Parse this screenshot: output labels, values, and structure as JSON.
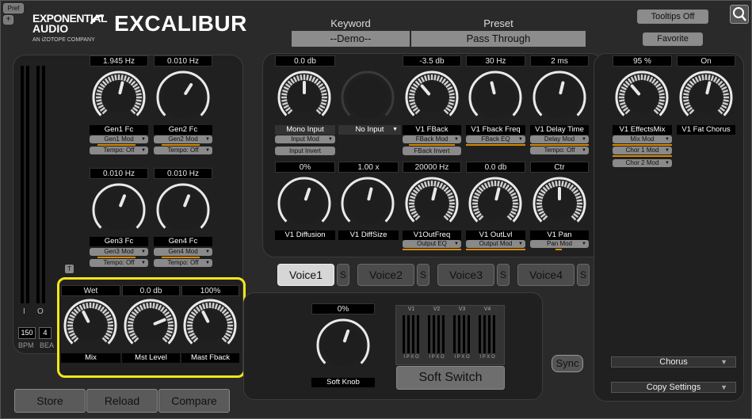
{
  "header": {
    "pref_label": "Pref",
    "plus_label": "+",
    "brand_line1": "EXPONENTIAL",
    "brand_line2": "AUDIO",
    "brand_sub": "AN iZOTOPE COMPANY",
    "product": "EXCALIBUR",
    "keyword_label": "Keyword",
    "keyword_value": "--Demo--",
    "preset_label": "Preset",
    "preset_value": "Pass Through",
    "tooltips_label": "Tooltips Off",
    "favorite_label": "Favorite"
  },
  "left": {
    "meter_i": "I",
    "meter_o": "O",
    "bpm_value": "150",
    "beat_value": "4",
    "bpm_label": "BPM",
    "beat_label": "BEA",
    "t_label": "T"
  },
  "gens": [
    {
      "value": "1.945 Hz",
      "label": "Gen1 Fc",
      "mod": "Gen1 Mod",
      "tempo": "Tempo: Off"
    },
    {
      "value": "0.010 Hz",
      "label": "Gen2 Fc",
      "mod": "Gen2 Mod",
      "tempo": "Tempo: Off"
    },
    {
      "value": "0.010 Hz",
      "label": "Gen3 Fc",
      "mod": "Gen3 Mod",
      "tempo": "Tempo: Off"
    },
    {
      "value": "0.010 Hz",
      "label": "Gen4 Fc",
      "mod": "Gen4 Mod",
      "tempo": "Tempo: Off"
    }
  ],
  "master": {
    "mix_value": "Wet",
    "mix_label": "Mix",
    "level_value": "0.0 db",
    "level_label": "Mst Level",
    "fback_value": "100%",
    "fback_label": "Mast Fback"
  },
  "voice_row1": {
    "input_value": "0.0 db",
    "input_label": "Mono Input",
    "input_mod": "Input Mod",
    "input_invert": "Input Invert",
    "noinput_label": "No Input",
    "fback_value": "-3.5 db",
    "fback_label": "V1 FBack",
    "fback_mod": "FBack Mod",
    "fback_invert": "FBack Invert",
    "freq_value": "30 Hz",
    "freq_label": "V1 Fback Freq",
    "freq_mod": "FBack EQ",
    "delay_value": "2 ms",
    "delay_label": "V1 Delay Time",
    "delay_mod": "Delay Mod",
    "delay_tempo": "Tempo: Off"
  },
  "voice_row2": {
    "diff_value": "0%",
    "diff_label": "V1 Diffusion",
    "size_value": "1.00 x",
    "size_label": "V1 DiffSize",
    "outfreq_value": "20000 Hz",
    "outfreq_label": "V1OutFreq",
    "outfreq_mod": "Output EQ",
    "outlvl_value": "0.0 db",
    "outlvl_label": "V1 OutLvl",
    "outlvl_mod": "Output Mod",
    "pan_value": "Ctr",
    "pan_label": "V1 Pan",
    "pan_mod": "Pan Mod"
  },
  "effects": {
    "mix_value": "95 %",
    "mix_label": "V1 EffectsMix",
    "mix_mod": "Mix Mod",
    "chor1": "Chor 1 Mod",
    "chor2": "Chor 2 Mod",
    "chorus_value": "On",
    "chorus_label": "V1 Fat Chorus",
    "chorus_select": "Chorus",
    "copy_settings": "Copy Settings"
  },
  "voices": [
    "Voice1",
    "Voice2",
    "Voice3",
    "Voice4"
  ],
  "solo_label": "S",
  "soft": {
    "value": "0%",
    "label": "Soft Knob",
    "switch_label": "Soft Switch",
    "channels": [
      "V1",
      "V2",
      "V3",
      "V4"
    ],
    "ipxo": "IPXO",
    "sync_label": "Sync"
  },
  "footer": {
    "store": "Store",
    "reload": "Reload",
    "compare": "Compare"
  },
  "colors": {
    "accent": "#d88a00",
    "highlight": "#f2e61c"
  },
  "knob_positions": {
    "gen1": 0.55,
    "gen2": 0.62,
    "gen3": 0.58,
    "gen4": 0.58,
    "mix": 0.4,
    "level": 0.75,
    "fback": 0.4,
    "input": 0.5,
    "noinput": 0.5,
    "fback_v": 0.35,
    "freq": 0.45,
    "delay": 0.55,
    "diff": 0.57,
    "size": 0.55,
    "outfreq": 0.55,
    "outlvl": 0.55,
    "pan": 0.5,
    "effmix": 0.35,
    "chorus": 0.55,
    "soft": 0.57
  }
}
